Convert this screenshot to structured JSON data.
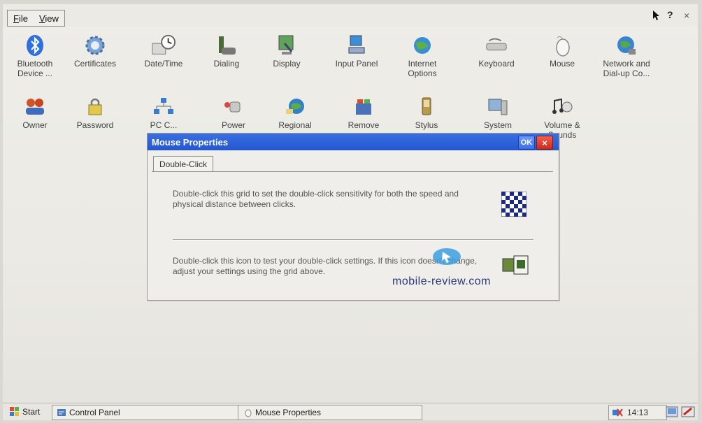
{
  "menubar": {
    "menus": [
      "File",
      "View"
    ],
    "help_label": "?",
    "close_label": "×"
  },
  "icons": [
    {
      "label": "Bluetooth Device ...",
      "icon": "bluetooth-icon"
    },
    {
      "label": "Certificates",
      "icon": "certificates-icon"
    },
    {
      "label": "Date/Time",
      "icon": "date-time-icon"
    },
    {
      "label": "Dialing",
      "icon": "dialing-icon"
    },
    {
      "label": "Display",
      "icon": "display-icon"
    },
    {
      "label": "Input Panel",
      "icon": "input-panel-icon"
    },
    {
      "label": "Internet Options",
      "icon": "internet-options-icon"
    },
    {
      "label": "Keyboard",
      "icon": "keyboard-icon"
    },
    {
      "label": "Mouse",
      "icon": "mouse-icon"
    },
    {
      "label": "Network and Dial-up Co...",
      "icon": "network-icon"
    },
    {
      "label": "Owner",
      "icon": "owner-icon"
    },
    {
      "label": "Password",
      "icon": "password-icon"
    },
    {
      "label": "PC C...",
      "icon": "pc-connection-icon"
    },
    {
      "label": "Power",
      "icon": "power-icon"
    },
    {
      "label": "Regional",
      "icon": "regional-icon"
    },
    {
      "label": "Remove",
      "icon": "remove-programs-icon"
    },
    {
      "label": "Stylus",
      "icon": "stylus-icon"
    },
    {
      "label": "System",
      "icon": "system-icon"
    },
    {
      "label": "Volume & Sounds",
      "icon": "volume-sounds-icon"
    }
  ],
  "dialog": {
    "title": "Mouse Properties",
    "ok_label": "OK",
    "close_label": "×",
    "tab": "Double-Click",
    "text1": "Double-click this grid to set the double-click sensitivity for both the speed and physical distance between clicks.",
    "text2": "Double-click this icon to test your double-click settings. If this icon doesn't change, adjust your settings using the grid above.",
    "watermark": "mobile-review.com"
  },
  "taskbar": {
    "start_label": "Start",
    "tasks": [
      "Control Panel",
      "Mouse Properties"
    ],
    "clock": "14:13"
  },
  "colors": {
    "titlebar": "#2457d3",
    "close": "#cc2a1c",
    "desktop": "#ebeae4"
  }
}
